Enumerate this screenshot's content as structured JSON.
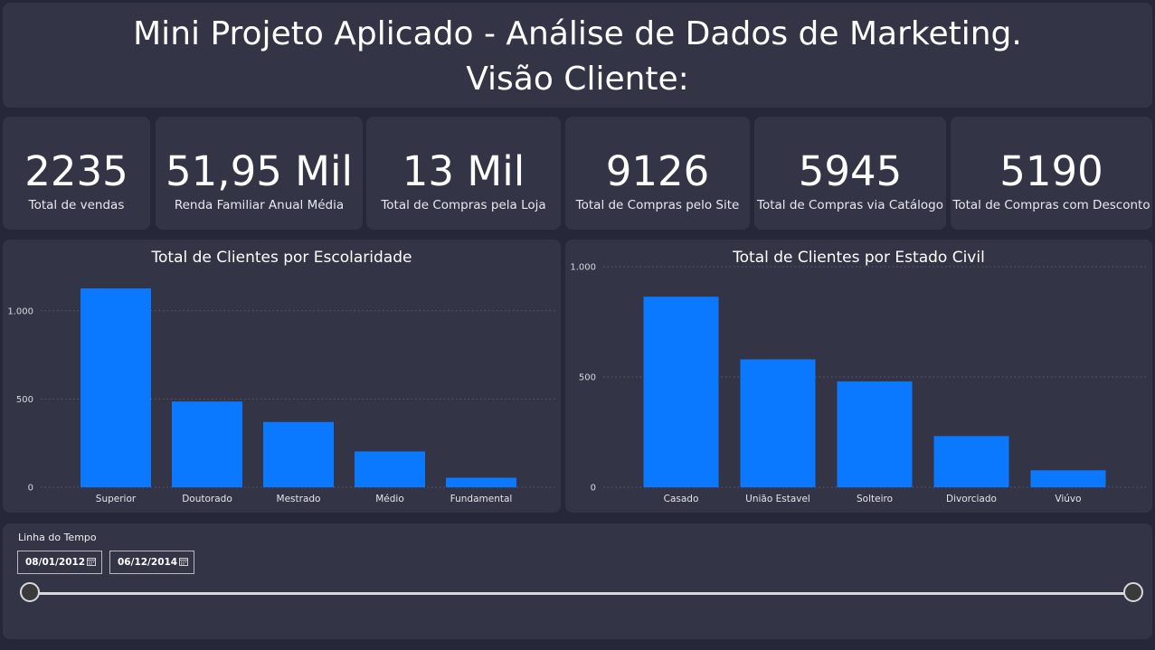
{
  "header": {
    "title_line1": "Mini Projeto Aplicado - Análise de Dados de Marketing.",
    "title_line2": "Visão Cliente:"
  },
  "kpis": [
    {
      "value": "2235",
      "label": "Total de vendas"
    },
    {
      "value": "51,95 Mil",
      "label": "Renda Familiar Anual Média"
    },
    {
      "value": "13 Mil",
      "label": "Total de Compras pela Loja"
    },
    {
      "value": "9126",
      "label": "Total de Compras pelo Site"
    },
    {
      "value": "5945",
      "label": "Total de Compras via Catálogo"
    },
    {
      "value": "5190",
      "label": "Total de Compras com Desconto"
    }
  ],
  "chart_data": [
    {
      "type": "bar",
      "title": "Total de Clientes por Escolaridade",
      "categories": [
        "Superior",
        "Doutorado",
        "Mestrado",
        "Médio",
        "Fundamental"
      ],
      "values": [
        1127,
        486,
        370,
        203,
        54
      ],
      "ylim": [
        0,
        1250
      ],
      "yticks": [
        0,
        500,
        1000
      ],
      "ytick_labels": [
        "0",
        "500",
        "1.000"
      ],
      "grid": true,
      "color": "#0a78ff"
    },
    {
      "type": "bar",
      "title": "Total de Clientes por Estado Civil",
      "categories": [
        "Casado",
        "União Estavel",
        "Solteiro",
        "Divorciado",
        "Viúvo"
      ],
      "values": [
        864,
        580,
        480,
        232,
        77
      ],
      "ylim": [
        0,
        1000
      ],
      "yticks": [
        0,
        500,
        1000
      ],
      "ytick_labels": [
        "0",
        "500",
        "1.000"
      ],
      "grid": true,
      "color": "#0a78ff"
    }
  ],
  "timeline": {
    "title": "Linha do Tempo",
    "start_date": "08/01/2012",
    "end_date": "06/12/2014",
    "range_fraction": [
      0,
      1
    ]
  }
}
